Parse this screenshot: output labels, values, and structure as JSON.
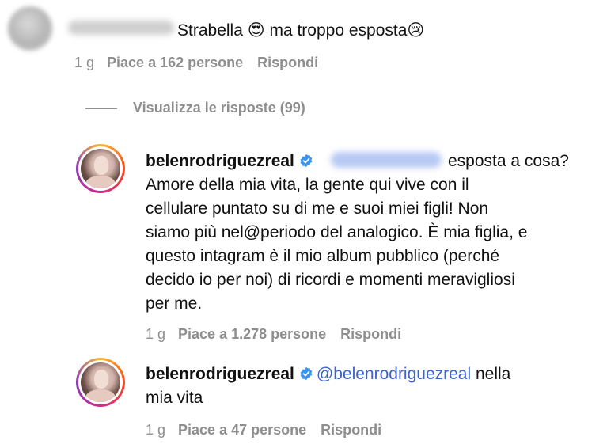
{
  "comment1": {
    "text_before_emoji1": "Strabella ",
    "emoji1": "😍",
    "text_middle": " ma troppo esposta",
    "emoji2": "😢",
    "time": "1 g",
    "likes": "Piace a 162 persone",
    "reply": "Rispondi"
  },
  "replies_toggle": "Visualizza le risposte (99)",
  "reply1": {
    "username": "belenrodriguezreal",
    "first_line_after_mention": " esposta a cosa?",
    "lines": [
      "Amore della mia vita, la gente qui vive con il",
      "cellulare puntato su di me e suoi miei figli! Non",
      "siamo più nel@periodo del analogico. È mia figlia, e",
      "questo intagram è il mio album pubblico (perché",
      "decido io per noi) di ricordi e momenti meravigliosi",
      "per me."
    ],
    "time": "1 g",
    "likes": "Piace a 1.278 persone",
    "reply": "Rispondi"
  },
  "reply2": {
    "username": "belenrodriguezreal",
    "mention": "@belenrodriguezreal",
    "text_after_mention": " nella",
    "line2": "mia vita",
    "time": "1 g",
    "likes": "Piace a 47 persone",
    "reply": "Rispondi"
  },
  "colors": {
    "mention": "#3d63c9",
    "meta": "#8e8e8e",
    "verified": "#3897f0"
  },
  "icons": [
    "verified-badge-icon"
  ]
}
